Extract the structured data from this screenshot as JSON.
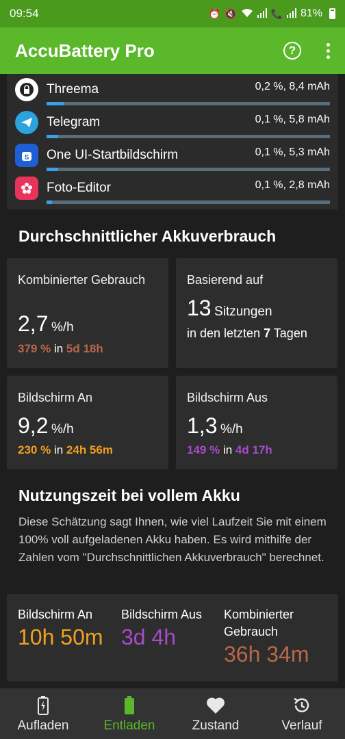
{
  "status": {
    "time": "09:54",
    "battery": "81%"
  },
  "appbar": {
    "title": "AccuBattery Pro"
  },
  "apps": [
    {
      "name": "Threema",
      "value": "0,2 %, 8,4 mAh",
      "fill": 0.06,
      "icon_color": "#ffffff",
      "icon": "lock-icon"
    },
    {
      "name": "Telegram",
      "value": "0,1 %, 5,8 mAh",
      "fill": 0.04,
      "icon_color": "#2aa3df",
      "icon": "paper-plane-icon"
    },
    {
      "name": "One UI-Startbildschirm",
      "value": "0,1 %, 5,3 mAh",
      "fill": 0.04,
      "icon_color": "#1f5fd6",
      "icon": "bag-icon"
    },
    {
      "name": "Foto-Editor",
      "value": "0,1 %, 2,8 mAh",
      "fill": 0.02,
      "icon_color": "#e8335a",
      "icon": "flower-icon"
    }
  ],
  "avg": {
    "title": "Durchschnittlicher Akkuverbrauch",
    "combined": {
      "label": "Kombinierter Gebrauch",
      "value": "2,7",
      "unit": "%/h",
      "pct": "379 %",
      "in": "in",
      "dur": "5d 18h",
      "color": "#b8684a"
    },
    "based": {
      "label": "Basierend auf",
      "count": "13",
      "sessions": "Sitzungen",
      "line2_a": "in den letzten",
      "days": "7",
      "line2_b": "Tagen"
    },
    "screen_on": {
      "label": "Bildschirm An",
      "value": "9,2",
      "unit": "%/h",
      "pct": "230 %",
      "in": "in",
      "dur": "24h 56m",
      "color": "#f0a020"
    },
    "screen_off": {
      "label": "Bildschirm Aus",
      "value": "1,3",
      "unit": "%/h",
      "pct": "149 %",
      "in": "in",
      "dur": "4d 17h",
      "color": "#a74bc8"
    }
  },
  "full": {
    "title": "Nutzungszeit bei vollem Akku",
    "desc": "Diese Schätzung sagt Ihnen, wie viel Laufzeit Sie mit einem 100% voll aufgeladenen Akku haben. Es wird mithilfe der Zahlen vom \"Durchschnittlichen Akkuverbrauch\" berechnet.",
    "screen_on": {
      "label": "Bildschirm An",
      "value": "10h 50m",
      "color": "#f0a020"
    },
    "screen_off": {
      "label": "Bildschirm Aus",
      "value": "3d 4h",
      "color": "#a74bc8"
    },
    "combined": {
      "label": "Kombinierter Gebrauch",
      "value": "36h 34m",
      "color": "#b8684a"
    }
  },
  "nav": [
    {
      "label": "Aufladen",
      "icon": "battery-charging-icon"
    },
    {
      "label": "Entladen",
      "icon": "battery-icon",
      "active": true
    },
    {
      "label": "Zustand",
      "icon": "heart-icon"
    },
    {
      "label": "Verlauf",
      "icon": "history-icon"
    }
  ]
}
